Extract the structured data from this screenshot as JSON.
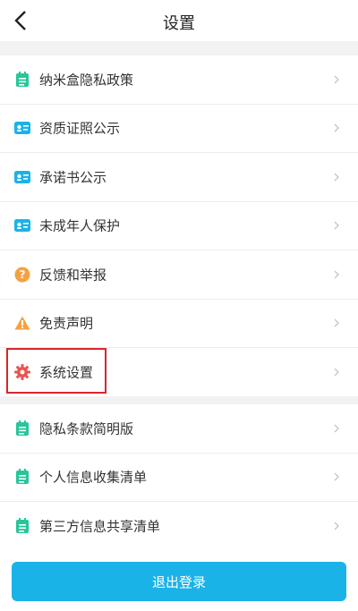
{
  "header": {
    "title": "设置"
  },
  "group1": [
    {
      "label": "纳米盒隐私政策",
      "icon": "notepad-icon"
    },
    {
      "label": "资质证照公示",
      "icon": "id-card-icon"
    },
    {
      "label": "承诺书公示",
      "icon": "id-card-icon"
    },
    {
      "label": "未成年人保护",
      "icon": "id-card-icon"
    },
    {
      "label": "反馈和举报",
      "icon": "question-circle-icon"
    },
    {
      "label": "免责声明",
      "icon": "warning-icon"
    },
    {
      "label": "系统设置",
      "icon": "gear-icon"
    }
  ],
  "group2": [
    {
      "label": "隐私条款简明版",
      "icon": "notepad-icon"
    },
    {
      "label": "个人信息收集清单",
      "icon": "notepad-icon"
    },
    {
      "label": "第三方信息共享清单",
      "icon": "notepad-icon"
    }
  ],
  "logout_label": "退出登录",
  "colors": {
    "accent": "#1ab3e8",
    "green": "#27c69a",
    "orange": "#f5a142",
    "red": "#e9544e",
    "highlight": "#d9262c"
  }
}
